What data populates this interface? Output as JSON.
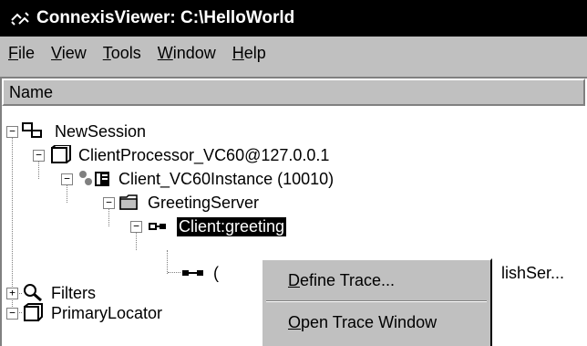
{
  "window": {
    "title": "ConnexisViewer: C:\\HelloWorld"
  },
  "menubar": {
    "items": [
      {
        "label": "File",
        "mnemonic": "F",
        "rest": "ile"
      },
      {
        "label": "View",
        "mnemonic": "V",
        "rest": "iew"
      },
      {
        "label": "Tools",
        "mnemonic": "T",
        "rest": "ools"
      },
      {
        "label": "Window",
        "mnemonic": "W",
        "rest": "indow"
      },
      {
        "label": "Help",
        "mnemonic": "H",
        "rest": "elp"
      }
    ]
  },
  "tree": {
    "column_header": "Name",
    "nodes": [
      {
        "label": "NewSession",
        "expander": "−",
        "icon": "session-icon"
      },
      {
        "label": "ClientProcessor_VC60@127.0.0.1",
        "expander": "−",
        "icon": "processor-icon"
      },
      {
        "label": "Client_VC60Instance (10010)",
        "expander": "−",
        "icon": "instance-icon"
      },
      {
        "label": "GreetingServer",
        "expander": "−",
        "icon": "folder-icon"
      },
      {
        "label": "Client:greeting",
        "expander": "−",
        "icon": "port-icon"
      },
      {
        "label": "(",
        "icon": "connection-icon",
        "trailing": "lishSer..."
      },
      {
        "label": "Filters",
        "expander": "+",
        "icon": "filter-icon"
      },
      {
        "label": "PrimaryLocator",
        "expander": "−",
        "icon": "locator-icon"
      }
    ]
  },
  "context_menu": {
    "items": [
      {
        "label": "Define Trace...",
        "mnemonic": "D",
        "rest": "efine Trace..."
      },
      {
        "label": "Open Trace Window",
        "mnemonic": "O",
        "rest": "pen Trace Window"
      }
    ]
  }
}
